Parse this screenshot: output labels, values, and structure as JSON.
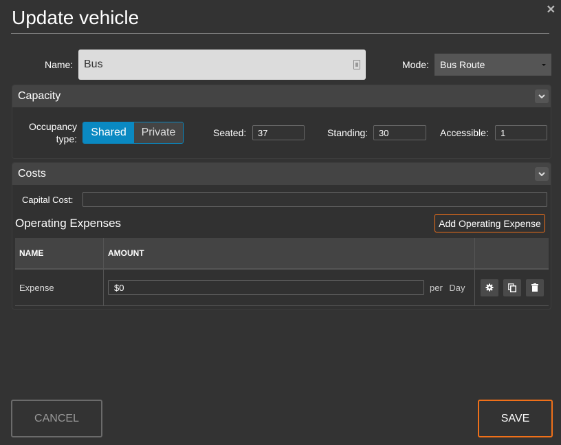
{
  "dialog": {
    "title": "Update vehicle",
    "close_icon": "close-icon"
  },
  "form": {
    "name_label": "Name:",
    "name_value": "Bus",
    "name_icon": "contact-card-icon",
    "mode_label": "Mode:",
    "mode_value": "Bus Route"
  },
  "capacity": {
    "header": "Capacity",
    "occupancy_label_line1": "Occupancy",
    "occupancy_label_line2": "type:",
    "occupancy_options": [
      "Shared",
      "Private"
    ],
    "occupancy_selected": "Shared",
    "seated_label": "Seated:",
    "seated_value": "37",
    "standing_label": "Standing:",
    "standing_value": "30",
    "accessible_label": "Accessible:",
    "accessible_value": "1"
  },
  "costs": {
    "header": "Costs",
    "capital_cost_label": "Capital Cost:",
    "capital_cost_value": "",
    "operating_expenses_title": "Operating Expenses",
    "add_button_label": "Add Operating Expense",
    "table": {
      "columns": [
        "NAME",
        "AMOUNT",
        ""
      ],
      "rows": [
        {
          "name": "Expense",
          "amount": "$0",
          "per": "per",
          "period": "Day"
        }
      ],
      "row_actions": [
        "gear-icon",
        "copy-icon",
        "trash-icon"
      ]
    }
  },
  "footer": {
    "cancel_label": "CANCEL",
    "save_label": "SAVE"
  },
  "colors": {
    "accent_orange": "#f07019",
    "toggle_blue": "#0a89c2",
    "background": "#333333"
  }
}
